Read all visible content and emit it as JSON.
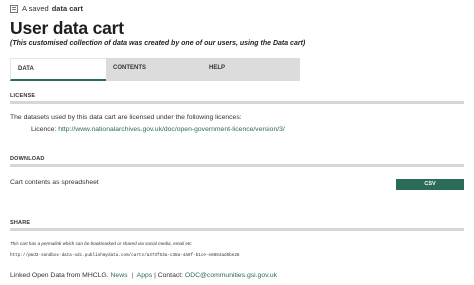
{
  "breadcrumb": {
    "prefix": "A saved",
    "strong": "data cart"
  },
  "page": {
    "title": "User data cart",
    "subtitle": "(This customised collection of data was created by one of our users, using the Data cart)"
  },
  "tabs": [
    {
      "label": "DATA",
      "active": true
    },
    {
      "label": "CONTENTS",
      "active": false
    },
    {
      "label": "HELP",
      "active": false
    }
  ],
  "license": {
    "heading": "LICENSE",
    "intro": "The datasets used by this data cart are licensed under the following licences:",
    "licence_label": "Licence:",
    "licence_url": "http://www.nationalarchives.gov.uk/doc/open-government-licence/version/3/"
  },
  "download": {
    "heading": "DOWNLOAD",
    "text": "Cart contents as spreadsheet",
    "button_label": "CSV"
  },
  "share": {
    "heading": "SHARE",
    "note": "This cart has a permalink which can be bookmarked or shared via social media, email etc",
    "permalink": "http://pmd3-sandbox-data-odc.publishmydata.com/carts/a373f53a-c38a-4a9f-b1ce-e8864ad5be28"
  },
  "footer": {
    "prefix": "Linked Open Data from MHCLG.",
    "news": "News",
    "sep": "|",
    "apps": "Apps",
    "contact_label": "| Contact:",
    "contact_email": "ODC@communities.gsi.gov.uk"
  },
  "colors": {
    "accent": "#2b6b59",
    "tab_inactive": "#dcdcdc",
    "rule": "#d6d6d6"
  }
}
